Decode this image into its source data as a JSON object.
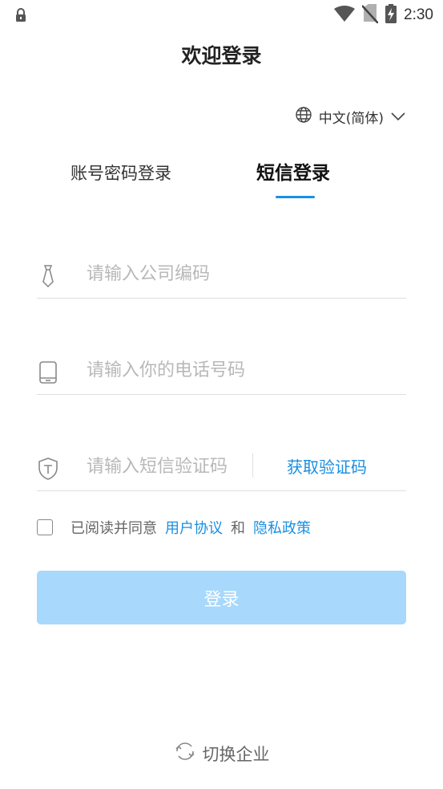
{
  "status_bar": {
    "time": "2:30",
    "icons": [
      "lock-icon",
      "wifi-icon",
      "no-sim-icon",
      "battery-charging-icon"
    ]
  },
  "header": {
    "title": "欢迎登录"
  },
  "language": {
    "label": "中文(简体)",
    "icon": "globe-icon"
  },
  "tabs": [
    {
      "label": "账号密码登录",
      "active": false
    },
    {
      "label": "短信登录",
      "active": true
    }
  ],
  "form": {
    "company": {
      "placeholder": "请输入公司编码",
      "value": "",
      "icon": "tie-icon"
    },
    "phone": {
      "placeholder": "请输入你的电话号码",
      "value": "",
      "icon": "phone-icon"
    },
    "code": {
      "placeholder": "请输入短信验证码",
      "value": "",
      "icon": "shield-icon",
      "get_code_label": "获取验证码"
    }
  },
  "agreement": {
    "prefix": "已阅读并同意",
    "user_agreement": "用户协议",
    "and": "和",
    "privacy_policy": "隐私政策",
    "checked": false
  },
  "login_button": {
    "label": "登录"
  },
  "switch_company": {
    "label": "切换企业",
    "icon": "refresh-icon"
  },
  "colors": {
    "accent": "#1a8fe0",
    "button_disabled": "#a8d8fb",
    "placeholder": "#b8b8b8"
  }
}
